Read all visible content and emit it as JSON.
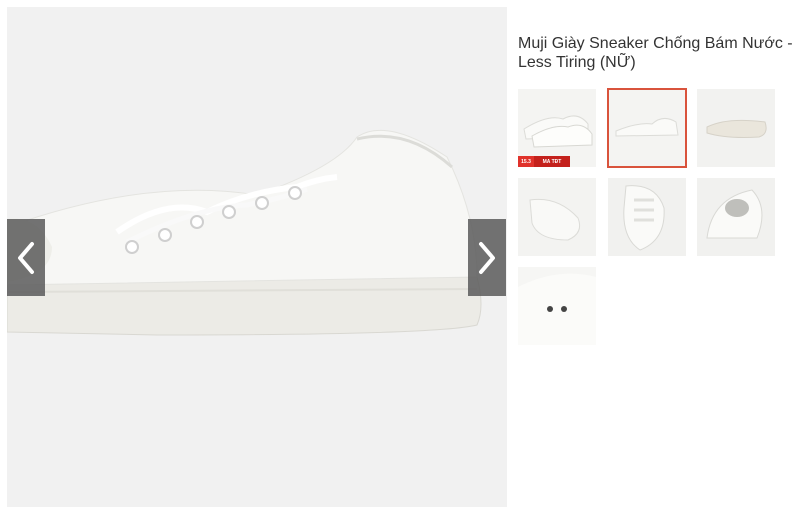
{
  "product": {
    "title": "Muji Giày Sneaker Chống Bám Nước - Less Tiring (NỮ)"
  },
  "gallery": {
    "selected_index": 1,
    "nav": {
      "prev_icon": "chevron-left-icon",
      "next_icon": "chevron-right-icon"
    },
    "thumb_badge": {
      "part1": "15.3",
      "part2": "MA TĐT"
    },
    "thumbnails": [
      "sneaker-pair",
      "sneaker-side",
      "sneaker-sole",
      "sneaker-back",
      "sneaker-laces",
      "sneaker-inside",
      "sneaker-eyelets"
    ]
  },
  "colors": {
    "accent": "#d9533c",
    "nav_bg": "#5a5a5a",
    "badge_red": "#e0322b"
  }
}
